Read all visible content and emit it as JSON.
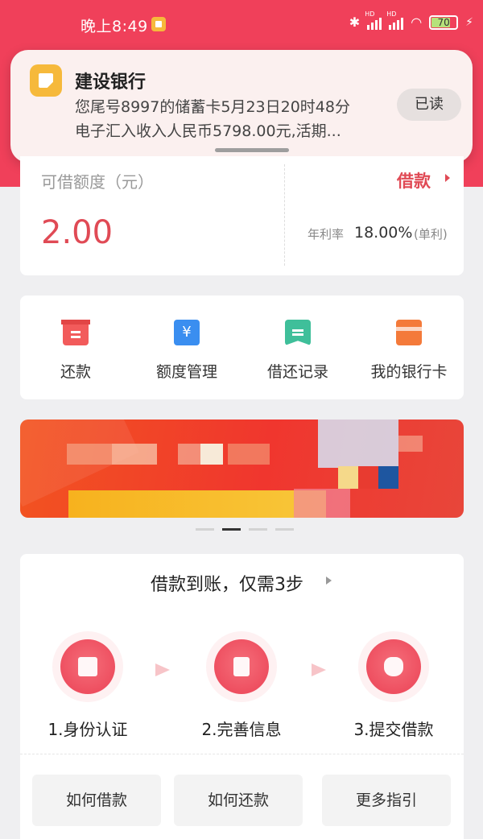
{
  "status_bar": {
    "time": "晚上8:49",
    "battery": "70",
    "signal_label": "HD"
  },
  "notification": {
    "app_name": "建设银行",
    "line1": "您尾号8997的储蓄卡5月23日20时48分",
    "line2": "电子汇入收入人民币5798.00元,活期...",
    "read_button": "已读"
  },
  "credit": {
    "label": "可借额度（元）",
    "amount": "2.00",
    "borrow_label": "借款",
    "rate_label": "年利率",
    "rate_value": "18.00%",
    "rate_note": "(单利)"
  },
  "actions": [
    {
      "label": "还款",
      "icon": "repay-icon"
    },
    {
      "label": "额度管理",
      "icon": "quota-icon",
      "glyph": "¥"
    },
    {
      "label": "借还记录",
      "icon": "record-icon"
    },
    {
      "label": "我的银行卡",
      "icon": "bank-card-icon"
    }
  ],
  "banner": {
    "slide_index": 2,
    "slide_count": 4
  },
  "steps": {
    "title": "借款到账，仅需3步",
    "items": [
      {
        "label": "1.身份认证"
      },
      {
        "label": "2.完善信息"
      },
      {
        "label": "3.提交借款"
      }
    ],
    "guides": [
      "如何借款",
      "如何还款",
      "更多指引"
    ]
  },
  "colors": {
    "brand_red": "#f0405a",
    "accent_red": "#e04a55",
    "notification_bg": "#fbf0ef"
  }
}
